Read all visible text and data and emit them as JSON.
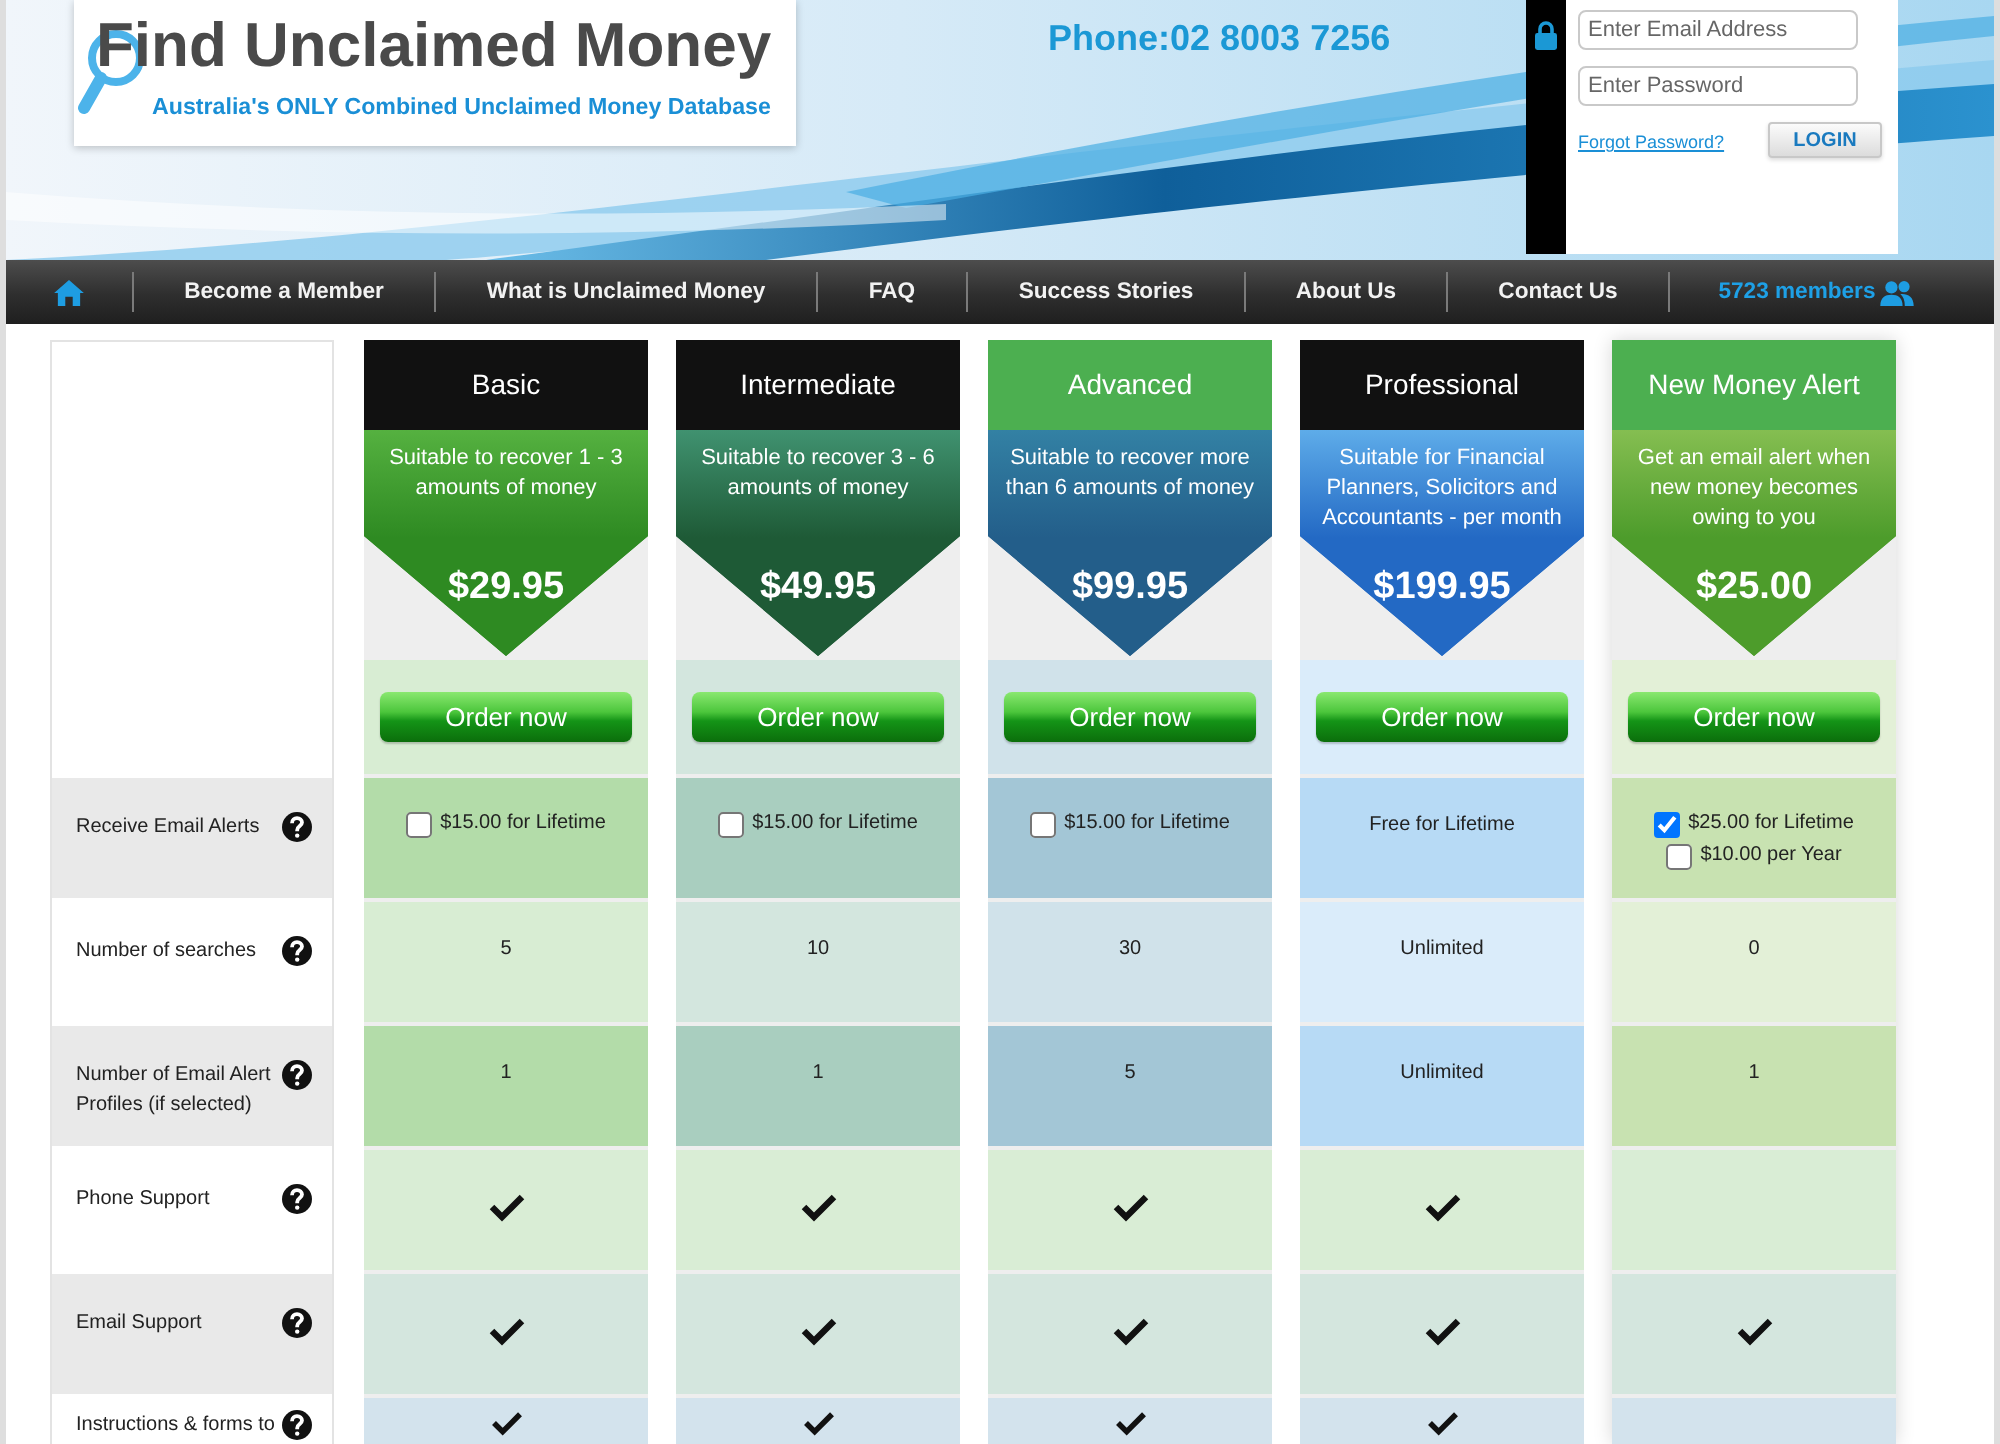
{
  "header": {
    "title": "Find Unclaimed Money",
    "tagline": "Australia's ONLY Combined Unclaimed Money Database",
    "phone": "Phone:02 8003 7256",
    "login": {
      "fields": [
        {
          "placeholder": "Enter Email Address"
        },
        {
          "placeholder": "Enter Password"
        }
      ],
      "forgot_link": "Forgot Password?",
      "button": "LOGIN"
    }
  },
  "nav": {
    "items": [
      "Become a Member",
      "What is Unclaimed Money",
      "FAQ",
      "Success Stories",
      "About Us",
      "Contact Us"
    ],
    "members": "5723 members"
  },
  "plans": [
    {
      "highlighted": false,
      "header": {
        "name": "Basic",
        "color": "#111111"
      },
      "banner": {
        "color": "#2e8a22",
        "description": "Suitable to recover 1 - 3 amounts of money",
        "price": "$29.95"
      },
      "order": {
        "color": "#d8edd3",
        "button": "Order now"
      }
    },
    {
      "highlighted": false,
      "header": {
        "name": "Intermediate",
        "color": "#111111"
      },
      "banner": {
        "color": "#1e5a36",
        "description": "Suitable to recover 3 - 6 amounts of money",
        "price": "$49.95"
      },
      "order": {
        "color": "#d3e6de",
        "button": "Order now"
      }
    },
    {
      "highlighted": false,
      "header": {
        "name": "Advanced",
        "color": "#4caf50"
      },
      "banner": {
        "color": "#235e8a",
        "description": "Suitable to recover more than 6 amounts of money",
        "price": "$99.95"
      },
      "order": {
        "color": "#d0e2ea",
        "button": "Order now"
      }
    },
    {
      "highlighted": false,
      "header": {
        "name": "Professional",
        "color": "#111111"
      },
      "banner": {
        "color": "#2369c4",
        "description": "Suitable for Financial Planners, Solicitors and Accountants - per month",
        "price": "$199.95"
      },
      "order": {
        "color": "#daecfa",
        "button": "Order now"
      }
    },
    {
      "highlighted": true,
      "header": {
        "name": "New Money Alert",
        "color": "#4caf50"
      },
      "banner": {
        "color": "#4d9c2b",
        "description": "Get an email alert when new money becomes owing to you",
        "price": "$25.00"
      },
      "order": {
        "color": "#e3f0d7",
        "button": "Order now"
      }
    }
  ],
  "features": [
    {
      "label": "Receive Email Alerts",
      "values": [
        {
          "kind": "options",
          "options": [
            {
              "label": "$15.00 for Lifetime",
              "checked": false
            }
          ]
        },
        {
          "kind": "options",
          "options": [
            {
              "label": "$15.00 for Lifetime",
              "checked": false
            }
          ]
        },
        {
          "kind": "options",
          "options": [
            {
              "label": "$15.00 for Lifetime",
              "checked": false
            }
          ]
        },
        {
          "kind": "text",
          "text": "Free for Lifetime"
        },
        {
          "kind": "options",
          "options": [
            {
              "label": "$25.00 for Lifetime",
              "checked": true
            },
            {
              "label": "$10.00 per Year",
              "checked": false
            }
          ]
        }
      ]
    },
    {
      "label": "Number of searches",
      "values": [
        {
          "kind": "text",
          "text": "5"
        },
        {
          "kind": "text",
          "text": "10"
        },
        {
          "kind": "text",
          "text": "30"
        },
        {
          "kind": "text",
          "text": "Unlimited"
        },
        {
          "kind": "text",
          "text": "0"
        }
      ]
    },
    {
      "label": "Number of Email Alert Profiles (if selected)",
      "values": [
        {
          "kind": "text",
          "text": "1"
        },
        {
          "kind": "text",
          "text": "1"
        },
        {
          "kind": "text",
          "text": "5"
        },
        {
          "kind": "text",
          "text": "Unlimited"
        },
        {
          "kind": "text",
          "text": "1"
        }
      ]
    },
    {
      "label": "Phone Support",
      "color": "#d9edd5",
      "values": [
        {
          "kind": "tick",
          "included": true
        },
        {
          "kind": "tick",
          "included": true
        },
        {
          "kind": "tick",
          "included": true
        },
        {
          "kind": "tick",
          "included": true
        },
        {
          "kind": "tick",
          "included": false
        }
      ]
    },
    {
      "label": "Email Support",
      "color": "#d4e6de",
      "values": [
        {
          "kind": "tick",
          "included": true
        },
        {
          "kind": "tick",
          "included": true
        },
        {
          "kind": "tick",
          "included": true
        },
        {
          "kind": "tick",
          "included": true
        },
        {
          "kind": "tick",
          "included": true
        }
      ]
    },
    {
      "label": "Instructions & forms to",
      "color": "#d3e3ed",
      "values": [
        {
          "kind": "tick",
          "included": true
        },
        {
          "kind": "tick",
          "included": true
        },
        {
          "kind": "tick",
          "included": true
        },
        {
          "kind": "tick",
          "included": true
        },
        {
          "kind": "tick",
          "included": false
        }
      ]
    }
  ]
}
